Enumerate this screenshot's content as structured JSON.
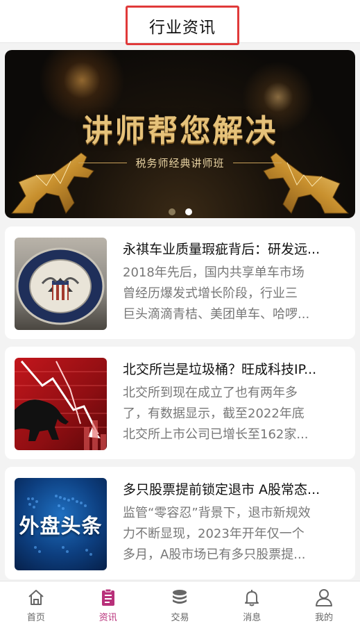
{
  "header": {
    "title": "行业资讯"
  },
  "banner": {
    "title": "讲师帮您解决",
    "subtitle": "税务师经典讲师班",
    "active_dot": 1,
    "dot_count": 2
  },
  "articles": [
    {
      "title": "永祺车业质量瑕疵背后：研发远...",
      "summary_lines": [
        "2018年先后，国内共享单车市场",
        "曾经历爆发式增长阶段，行业三",
        "巨头滴滴青桔、美团单车、哈啰..."
      ],
      "image": "federal-reserve-seal"
    },
    {
      "title": "北交所岂是垃圾桶？旺成科技IP...",
      "summary_lines": [
        "北交所到现在成立了也有两年多",
        "了，有数据显示，截至2022年底",
        "北交所上市公司已增长至162家..."
      ],
      "image": "bear-market-chart"
    },
    {
      "title": "多只股票提前锁定退市 A股常态...",
      "summary_lines": [
        "监管“零容忍”背景下，退市新规效",
        "力不断显现，2023年开年仅一个",
        "多月，A股市场已有多只股票提..."
      ],
      "image": "world-map",
      "image_text": "外盘头条"
    }
  ],
  "tabbar": {
    "items": [
      {
        "label": "首页",
        "icon": "home-icon",
        "active": false
      },
      {
        "label": "资讯",
        "icon": "clipboard-icon",
        "active": true
      },
      {
        "label": "交易",
        "icon": "coins-icon",
        "active": false
      },
      {
        "label": "消息",
        "icon": "bell-icon",
        "active": false
      },
      {
        "label": "我的",
        "icon": "user-icon",
        "active": false
      }
    ]
  },
  "colors": {
    "accent": "#b8307a",
    "inactive": "#666666",
    "highlight_box": "#e03a3a",
    "gold": "#e6c27a"
  }
}
